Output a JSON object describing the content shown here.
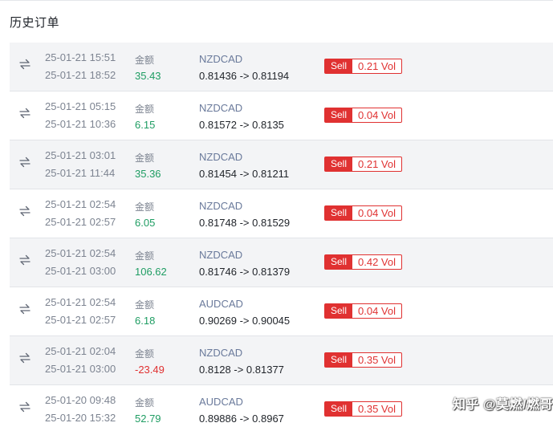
{
  "header": {
    "title": "历史订单"
  },
  "icons": {
    "row_icon": "swap-arrows-icon"
  },
  "colors": {
    "sell": "#e03131",
    "positive": "#1f9d63",
    "negative": "#e03131"
  },
  "orders": [
    {
      "open_time": "25-01-21 15:51",
      "close_time": "25-01-21 18:52",
      "amount_label": "金额",
      "amount": "35.43",
      "amount_sign": "pos",
      "symbol": "NZDCAD",
      "prices": "0.81436 -> 0.81194",
      "side": "Sell",
      "volume": "0.21 Vol"
    },
    {
      "open_time": "25-01-21 05:15",
      "close_time": "25-01-21 10:36",
      "amount_label": "金额",
      "amount": "6.15",
      "amount_sign": "pos",
      "symbol": "NZDCAD",
      "prices": "0.81572 -> 0.8135",
      "side": "Sell",
      "volume": "0.04 Vol"
    },
    {
      "open_time": "25-01-21 03:01",
      "close_time": "25-01-21 11:44",
      "amount_label": "金额",
      "amount": "35.36",
      "amount_sign": "pos",
      "symbol": "NZDCAD",
      "prices": "0.81454 -> 0.81211",
      "side": "Sell",
      "volume": "0.21 Vol"
    },
    {
      "open_time": "25-01-21 02:54",
      "close_time": "25-01-21 02:57",
      "amount_label": "金额",
      "amount": "6.05",
      "amount_sign": "pos",
      "symbol": "NZDCAD",
      "prices": "0.81748 -> 0.81529",
      "side": "Sell",
      "volume": "0.04 Vol"
    },
    {
      "open_time": "25-01-21 02:54",
      "close_time": "25-01-21 03:00",
      "amount_label": "金额",
      "amount": "106.62",
      "amount_sign": "pos",
      "symbol": "NZDCAD",
      "prices": "0.81746 -> 0.81379",
      "side": "Sell",
      "volume": "0.42 Vol"
    },
    {
      "open_time": "25-01-21 02:54",
      "close_time": "25-01-21 02:57",
      "amount_label": "金额",
      "amount": "6.18",
      "amount_sign": "pos",
      "symbol": "AUDCAD",
      "prices": "0.90269 -> 0.90045",
      "side": "Sell",
      "volume": "0.04 Vol"
    },
    {
      "open_time": "25-01-21 02:04",
      "close_time": "25-01-21 03:00",
      "amount_label": "金额",
      "amount": "-23.49",
      "amount_sign": "neg",
      "symbol": "NZDCAD",
      "prices": "0.8128 -> 0.81377",
      "side": "Sell",
      "volume": "0.35 Vol"
    },
    {
      "open_time": "25-01-20 09:48",
      "close_time": "25-01-20 15:32",
      "amount_label": "金额",
      "amount": "52.79",
      "amount_sign": "pos",
      "symbol": "AUDCAD",
      "prices": "0.89886 -> 0.8967",
      "side": "Sell",
      "volume": "0.35 Vol"
    }
  ],
  "watermark": {
    "text": "知乎 @莫燃/燃哥"
  }
}
